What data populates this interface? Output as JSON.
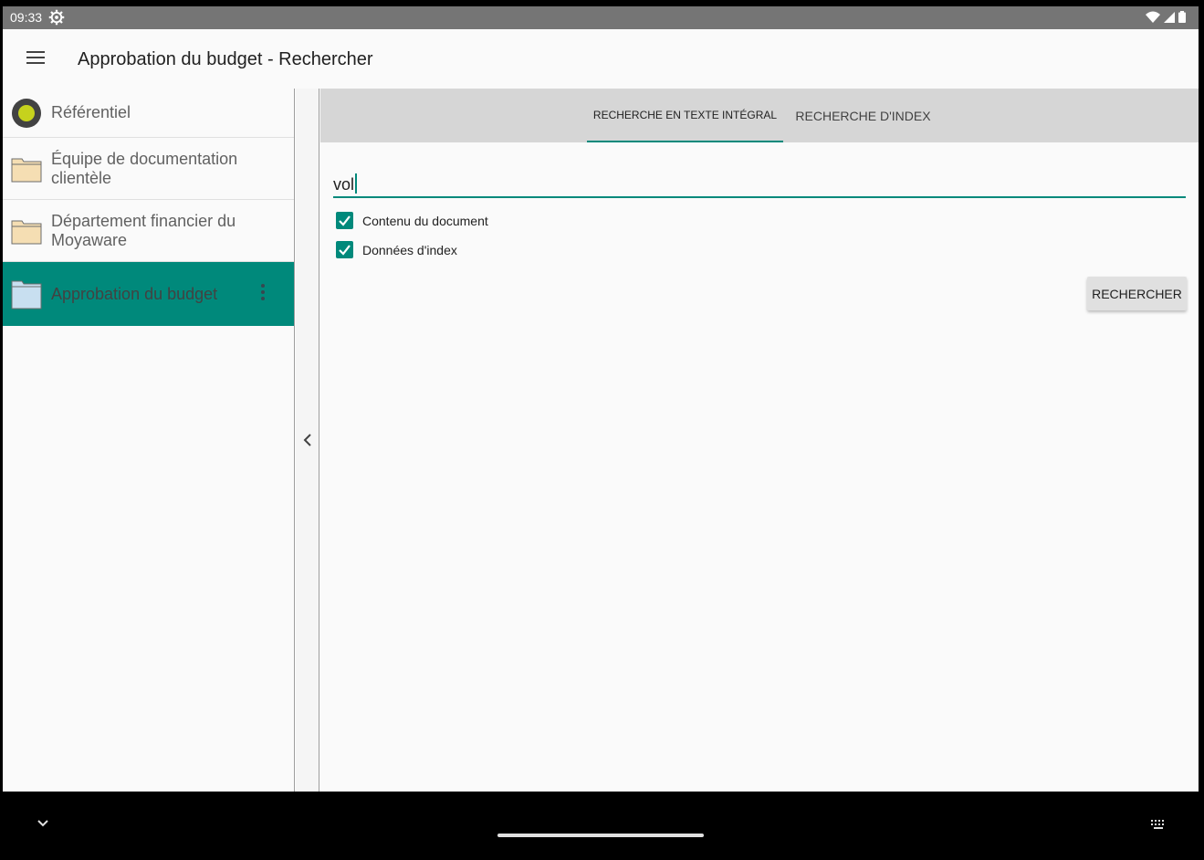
{
  "status_bar": {
    "time": "09:33"
  },
  "app_bar": {
    "title": "Approbation du budget - Rechercher"
  },
  "sidebar": {
    "items": [
      {
        "label": "Référentiel",
        "icon": "repository-icon"
      },
      {
        "label": "Équipe de documentation clientèle",
        "icon": "folder-icon"
      },
      {
        "label": "Département financier du Moyaware",
        "icon": "folder-icon"
      },
      {
        "label": "Approbation du budget",
        "icon": "folder-icon",
        "selected": true
      }
    ]
  },
  "tabs": [
    {
      "label": "RECHERCHE EN TEXTE INTÉGRAL",
      "active": true
    },
    {
      "label": "RECHERCHE D'INDEX",
      "active": false
    }
  ],
  "search": {
    "value": "vol",
    "options": [
      {
        "label": "Contenu du document",
        "checked": true
      },
      {
        "label": "Données d'index",
        "checked": true
      }
    ],
    "button_label": "RECHERCHER"
  },
  "colors": {
    "accent": "#00897b",
    "status_bar": "#757575",
    "tabs_bg": "#d6d6d6"
  }
}
